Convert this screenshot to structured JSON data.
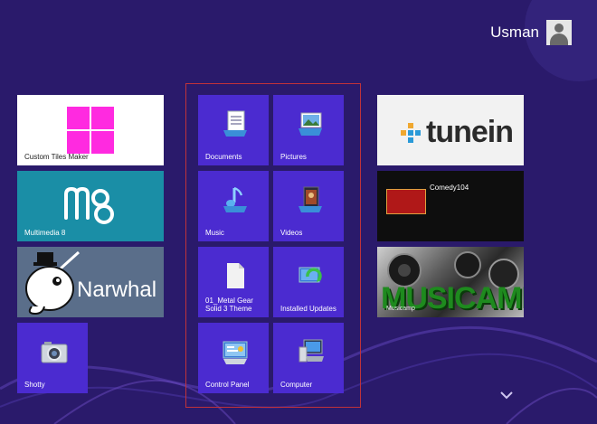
{
  "user": {
    "name": "Usman"
  },
  "colors": {
    "background": "#2a1a6b",
    "tile_purple": "#4b2bd0",
    "multimedia_teal": "#1a8ea6",
    "narwhal_slate": "#5a6e8a",
    "group_outline": "#c0323a",
    "custom_tiles_magenta": "#ff2ae0"
  },
  "left_tiles": [
    {
      "label": "Custom Tiles Maker",
      "icon": "magenta-grid-icon"
    },
    {
      "label": "Multimedia 8",
      "icon": "multimedia-8-logo"
    },
    {
      "label": "Narwhal",
      "icon": "narwhal-logo"
    },
    {
      "label": "Shotty",
      "icon": "camera-icon"
    }
  ],
  "group_tiles": [
    {
      "label": "Documents",
      "icon": "documents-icon"
    },
    {
      "label": "Pictures",
      "icon": "pictures-icon"
    },
    {
      "label": "Music",
      "icon": "music-icon"
    },
    {
      "label": "Videos",
      "icon": "videos-icon"
    },
    {
      "label": "01_Metal Gear Solid 3 Theme",
      "icon": "file-icon"
    },
    {
      "label": "Installed Updates",
      "icon": "installed-updates-icon"
    },
    {
      "label": "Control Panel",
      "icon": "control-panel-icon"
    },
    {
      "label": "Computer",
      "icon": "computer-icon"
    }
  ],
  "right_tiles": [
    {
      "label": "tunein",
      "icon": "tunein-logo"
    },
    {
      "label": "Comedy104",
      "icon": "comedy104-logo"
    },
    {
      "label": "MUSICAMP",
      "sublabel": "Musicamp",
      "icon": "musicamp-logo"
    }
  ],
  "scroll_hint": {
    "icon": "chevron-down-icon"
  }
}
